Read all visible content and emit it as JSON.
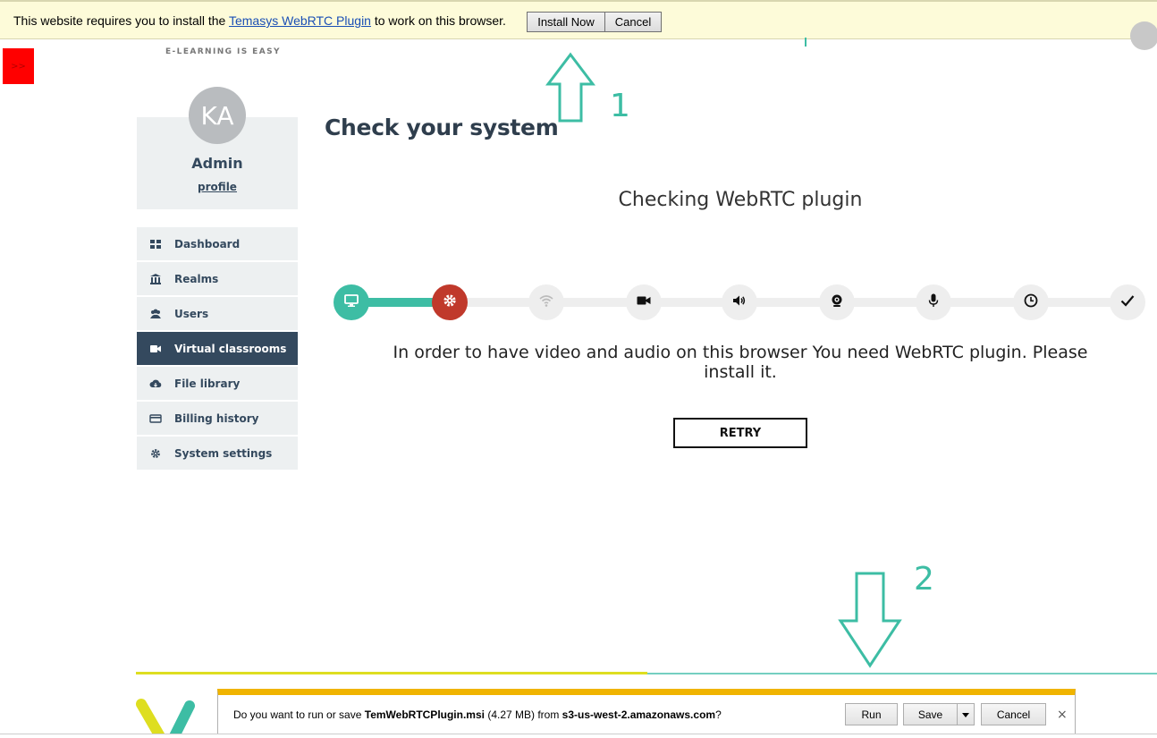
{
  "plugin_bar": {
    "message_before": "This website requires you to install the ",
    "link": "Temasys WebRTC Plugin",
    "message_after": " to work on this browser.",
    "install_label": "Install Now",
    "cancel_label": "Cancel"
  },
  "sidebar_toggle": ">>",
  "brand": {
    "tagline": "E-LEARNING IS EASY"
  },
  "profile": {
    "initials": "KA",
    "name": "Admin",
    "link": "profile"
  },
  "nav": {
    "items": [
      {
        "label": "Dashboard",
        "icon": "dashboard-icon",
        "active": false
      },
      {
        "label": "Realms",
        "icon": "bank-icon",
        "active": false
      },
      {
        "label": "Users",
        "icon": "users-icon",
        "active": false
      },
      {
        "label": "Virtual classrooms",
        "icon": "video-camera-icon",
        "active": true
      },
      {
        "label": "File library",
        "icon": "cloud-icon",
        "active": false
      },
      {
        "label": "Billing history",
        "icon": "credit-card-icon",
        "active": false
      },
      {
        "label": "System settings",
        "icon": "gear-icon",
        "active": false
      }
    ]
  },
  "main": {
    "title": "Check your system",
    "step_title": "Checking WebRTC plugin",
    "info": "In order to have video and audio on this browser You need WebRTC plugin. Please install it.",
    "retry_label": "RETRY",
    "steps": [
      {
        "icon": "monitor-icon",
        "state": "done"
      },
      {
        "icon": "gear-icon",
        "state": "current"
      },
      {
        "icon": "wifi-icon",
        "state": "pending"
      },
      {
        "icon": "video-camera-icon",
        "state": "pending"
      },
      {
        "icon": "speaker-icon",
        "state": "pending"
      },
      {
        "icon": "webcam-icon",
        "state": "pending"
      },
      {
        "icon": "microphone-icon",
        "state": "pending"
      },
      {
        "icon": "clock-icon",
        "state": "pending"
      },
      {
        "icon": "checkmark-icon",
        "state": "pending"
      }
    ]
  },
  "annotations": {
    "one": "1",
    "two": "2"
  },
  "download_bar": {
    "prefix": "Do you want to run or save ",
    "filename": "TemWebRTCPlugin.msi",
    "size": " (4.27 MB) from ",
    "source": "s3-us-west-2.amazonaws.com",
    "suffix": "?",
    "run_label": "Run",
    "save_label": "Save",
    "cancel_label": "Cancel",
    "close_glyph": "×"
  },
  "colors": {
    "accent": "#3dbda4",
    "active_nav": "#34495e",
    "error": "#c0392b",
    "notice_bg": "#fdfbd9"
  }
}
